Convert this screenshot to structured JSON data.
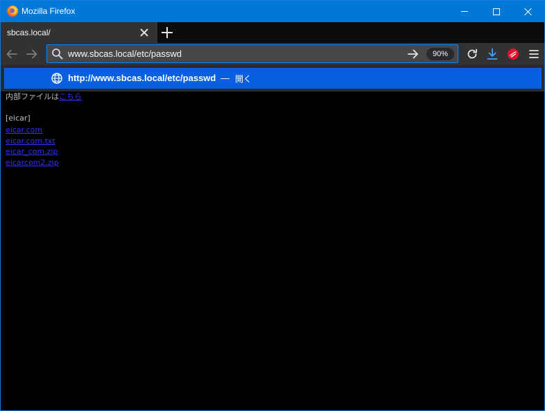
{
  "window": {
    "title": "Mozilla Firefox"
  },
  "tabs": [
    {
      "label": "sbcas.local/"
    }
  ],
  "urlbar": {
    "value": "www.sbcas.local/etc/passwd",
    "zoom": "90%"
  },
  "suggestion": {
    "url": "http://www.sbcas.local/etc/passwd",
    "separator": "—",
    "action": "開く"
  },
  "page": {
    "intro_text": "内部ファイルは",
    "intro_link": "こちら",
    "section_label": "[eicar]",
    "links": [
      "eicar.com",
      "eicar.com.txt",
      "eicar_com.zip",
      "eicarcom2.zip"
    ]
  },
  "colors": {
    "titlebar": "#0078d7",
    "accent": "#0a84ff",
    "suggestion_bg": "#0a5fe0",
    "link": "#2f2fff"
  }
}
